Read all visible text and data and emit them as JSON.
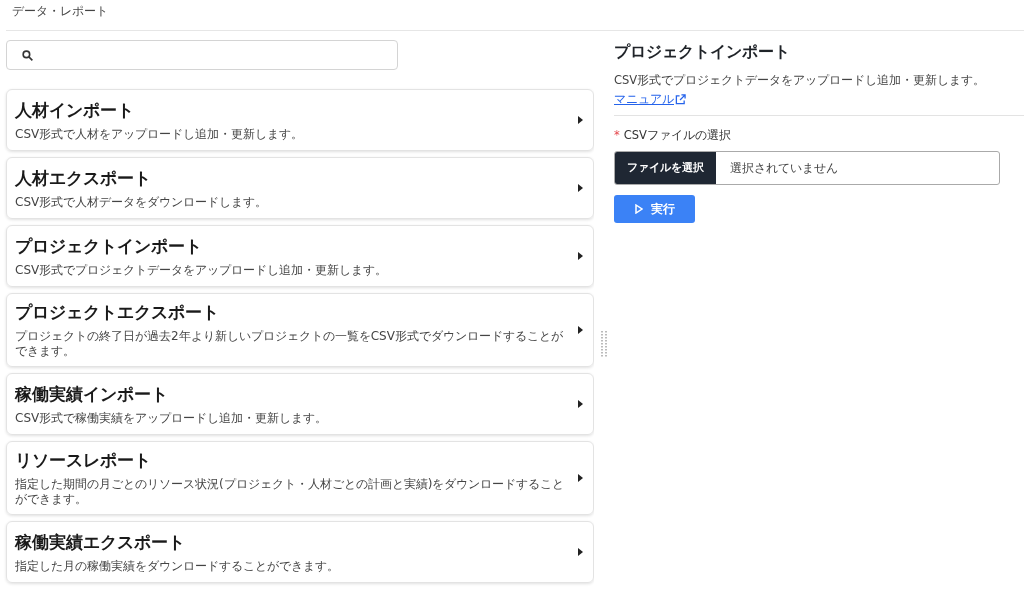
{
  "breadcrumb": "データ・レポート",
  "items": [
    {
      "title": "人材インポート",
      "description": "CSV形式で人材をアップロードし追加・更新します。"
    },
    {
      "title": "人材エクスポート",
      "description": "CSV形式で人材データをダウンロードします。"
    },
    {
      "title": "プロジェクトインポート",
      "description": "CSV形式でプロジェクトデータをアップロードし追加・更新します。"
    },
    {
      "title": "プロジェクトエクスポート",
      "description": "プロジェクトの終了日が過去2年より新しいプロジェクトの一覧をCSV形式でダウンロードすることができます。"
    },
    {
      "title": "稼働実績インポート",
      "description": "CSV形式で稼働実績をアップロードし追加・更新します。"
    },
    {
      "title": "リソースレポート",
      "description": "指定した期間の月ごとのリソース状況(プロジェクト・人材ごとの計画と実績)をダウンロードすることができます。"
    },
    {
      "title": "稼働実績エクスポート",
      "description": "指定した月の稼働実績をダウンロードすることができます。"
    }
  ],
  "detail": {
    "title": "プロジェクトインポート",
    "description": "CSV形式でプロジェクトデータをアップロードし追加・更新します。",
    "manual_link": "マニュアル",
    "field": {
      "required_mark": "*",
      "label": "CSVファイルの選択",
      "button": "ファイルを選択",
      "value": "選択されていません"
    },
    "run_button": "実行"
  }
}
